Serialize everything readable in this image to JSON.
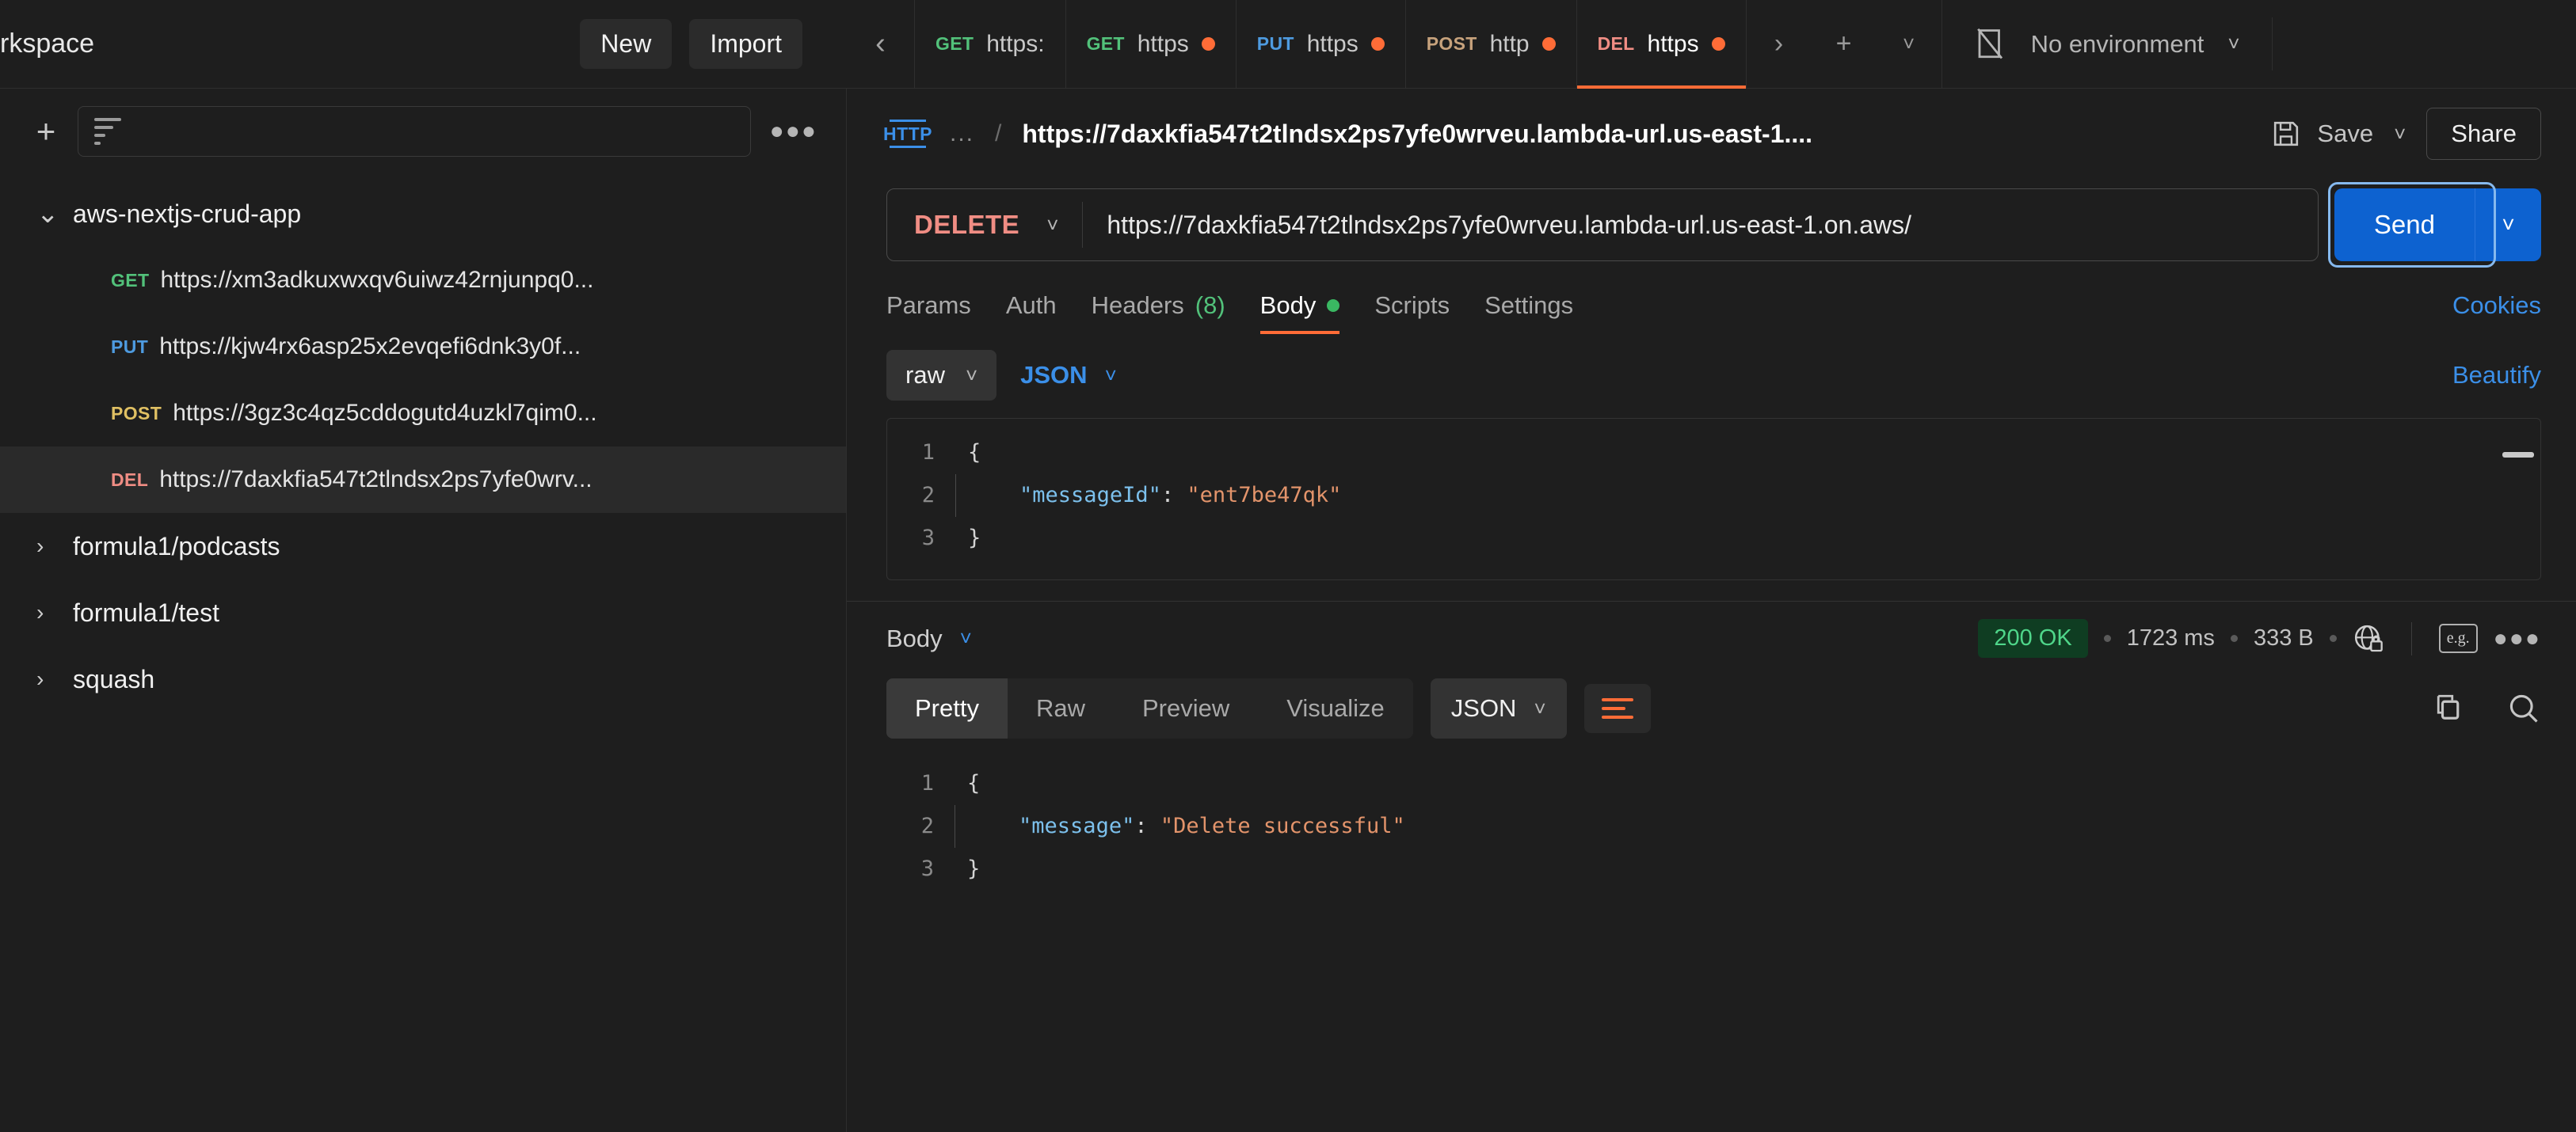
{
  "workspace": {
    "title": "rkspace",
    "new_label": "New",
    "import_label": "Import"
  },
  "tabbar": {
    "back_icon": "chevron-left-icon",
    "forward_icon": "chevron-right-icon",
    "new_tab_icon": "plus-icon",
    "tabs_dropdown_icon": "chevron-down-icon",
    "tabs": [
      {
        "method": "GET",
        "label": "https:",
        "unsaved": false,
        "active": false,
        "color": "#52c17a"
      },
      {
        "method": "GET",
        "label": "https",
        "unsaved": true,
        "active": false,
        "color": "#52c17a"
      },
      {
        "method": "PUT",
        "label": "https",
        "unsaved": true,
        "active": false,
        "color": "#4e9be0"
      },
      {
        "method": "POST",
        "label": "http",
        "unsaved": true,
        "active": false,
        "color": "#c7a27c"
      },
      {
        "method": "DEL",
        "label": "https",
        "unsaved": true,
        "active": true,
        "color": "#f08d84"
      }
    ],
    "environment": {
      "icon": "no-environment-icon",
      "label": "No environment",
      "caret": "chevron-down-icon"
    }
  },
  "sidebar": {
    "add_icon": "plus-icon",
    "search_placeholder": "",
    "search_value": "",
    "filter_icon": "filter-icon",
    "more_icon": "ellipsis-icon",
    "collections": [
      {
        "name": "aws-nextjs-crud-app",
        "expanded": true,
        "chevron": "chevron-down-icon"
      },
      {
        "name": "formula1/podcasts",
        "expanded": false,
        "chevron": "chevron-right-icon"
      },
      {
        "name": "formula1/test",
        "expanded": false,
        "chevron": "chevron-right-icon"
      },
      {
        "name": "squash",
        "expanded": false,
        "chevron": "chevron-right-icon"
      }
    ],
    "requests": [
      {
        "method": "GET",
        "url": "https://xm3adkuxwxqv6uiwz42rnjunpq0...",
        "color": "#52c17a",
        "selected": false
      },
      {
        "method": "PUT",
        "url": "https://kjw4rx6asp25x2evqefi6dnk3y0f...",
        "color": "#4e9be0",
        "selected": false
      },
      {
        "method": "POST",
        "url": "https://3gz3c4qz5cddogutd4uzkl7qim0...",
        "color": "#e0c063",
        "selected": false
      },
      {
        "method": "DEL",
        "url": "https://7daxkfia547t2tlndsx2ps7yfe0wrv...",
        "color": "#f08d84",
        "selected": true
      }
    ]
  },
  "request": {
    "protocol_badge": "HTTP",
    "breadcrumb_dots": "...",
    "breadcrumb_sep": "/",
    "title": "https://7daxkfia547t2tlndsx2ps7yfe0wrveu.lambda-url.us-east-1....",
    "save_label": "Save",
    "save_icon": "floppy-disk-icon",
    "save_caret_icon": "chevron-down-icon",
    "share_label": "Share",
    "method": "DELETE",
    "method_caret_icon": "chevron-down-icon",
    "url": "https://7daxkfia547t2tlndsx2ps7yfe0wrveu.lambda-url.us-east-1.on.aws/",
    "send_label": "Send",
    "send_caret_icon": "chevron-down-icon",
    "tabs": [
      {
        "label": "Params",
        "active": false,
        "count": "",
        "dot": false
      },
      {
        "label": "Auth",
        "active": false,
        "count": "",
        "dot": false
      },
      {
        "label": "Headers",
        "active": false,
        "count": "(8)",
        "dot": false
      },
      {
        "label": "Body",
        "active": true,
        "count": "",
        "dot": true
      },
      {
        "label": "Scripts",
        "active": false,
        "count": "",
        "dot": false
      },
      {
        "label": "Settings",
        "active": false,
        "count": "",
        "dot": false
      }
    ],
    "cookies_label": "Cookies",
    "body_mode": "raw",
    "body_mode_caret": "chevron-down-icon",
    "body_language": "JSON",
    "body_language_caret": "chevron-down-icon",
    "beautify_label": "Beautify",
    "body_lines": [
      {
        "no": "1",
        "open": "{",
        "key": "",
        "colon": "",
        "value": "",
        "close": ""
      },
      {
        "no": "2",
        "open": "",
        "key": "\"messageId\"",
        "colon": ": ",
        "value": "\"ent7be47qk\"",
        "close": ""
      },
      {
        "no": "3",
        "open": "}",
        "key": "",
        "colon": "",
        "value": "",
        "close": ""
      }
    ]
  },
  "response": {
    "body_label": "Body",
    "body_caret_icon": "chevron-down-icon",
    "status": "200 OK",
    "time": "1723 ms",
    "size": "333 B",
    "security_icon": "globe-lock-icon",
    "eg_icon": "e.g.",
    "more_icon": "ellipsis-icon",
    "view_tabs": [
      {
        "label": "Pretty",
        "active": true
      },
      {
        "label": "Raw",
        "active": false
      },
      {
        "label": "Preview",
        "active": false
      },
      {
        "label": "Visualize",
        "active": false
      }
    ],
    "language": "JSON",
    "language_caret_icon": "chevron-down-icon",
    "wrap_icon": "wrap-lines-icon",
    "copy_icon": "copy-icon",
    "search_icon": "search-icon",
    "body_lines": [
      {
        "no": "1",
        "open": "{",
        "key": "",
        "colon": "",
        "value": "",
        "close": ""
      },
      {
        "no": "2",
        "open": "",
        "key": "\"message\"",
        "colon": ": ",
        "value": "\"Delete successful\"",
        "close": ""
      },
      {
        "no": "3",
        "open": "}",
        "key": "",
        "colon": "",
        "value": "",
        "close": ""
      }
    ]
  },
  "colors": {
    "accent_orange": "#ff6c37",
    "link_blue": "#3b8fe8",
    "send_blue": "#0d62d0",
    "status_green": "#4fd68a",
    "bg": "#1e1e1e"
  }
}
